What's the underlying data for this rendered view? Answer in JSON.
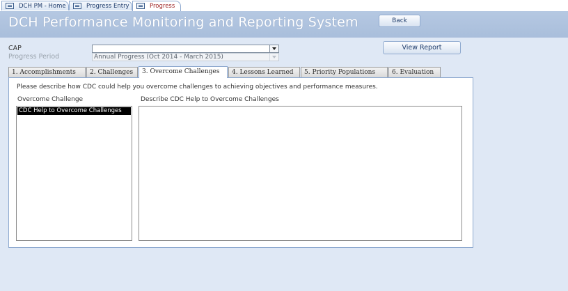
{
  "doc_tabs": [
    {
      "label": "DCH PM - Home"
    },
    {
      "label": "Progress Entry"
    },
    {
      "label": "Progress"
    }
  ],
  "header": {
    "title": "DCH Performance Monitoring and Reporting System",
    "back_label": "Back"
  },
  "filters": {
    "cap_label": "CAP",
    "cap_value": "",
    "period_label": "Progress Period",
    "period_value": "Annual Progress (Oct 2014 - March 2015)",
    "view_report_label": "View Report"
  },
  "tabs": [
    {
      "label": "1. Accomplishments"
    },
    {
      "label": "2. Challenges"
    },
    {
      "label": "3. Overcome Challenges"
    },
    {
      "label": "4. Lessons Learned"
    },
    {
      "label": "5. Priority Populations"
    },
    {
      "label": "6. Evaluation"
    }
  ],
  "panel": {
    "instruction": "Please describe how CDC could help you overcome challenges to achieving objectives and performance measures.",
    "list_header": "Overcome Challenge",
    "list_items": [
      "CDC Help to Overcome Challenges"
    ],
    "detail_header": "Describe CDC Help to Overcome Challenges",
    "detail_value": ""
  },
  "colors": {
    "header_band": "#b5c8e2",
    "background": "#dfe8f5",
    "active_doc_tab_text": "#9c1f1f"
  }
}
